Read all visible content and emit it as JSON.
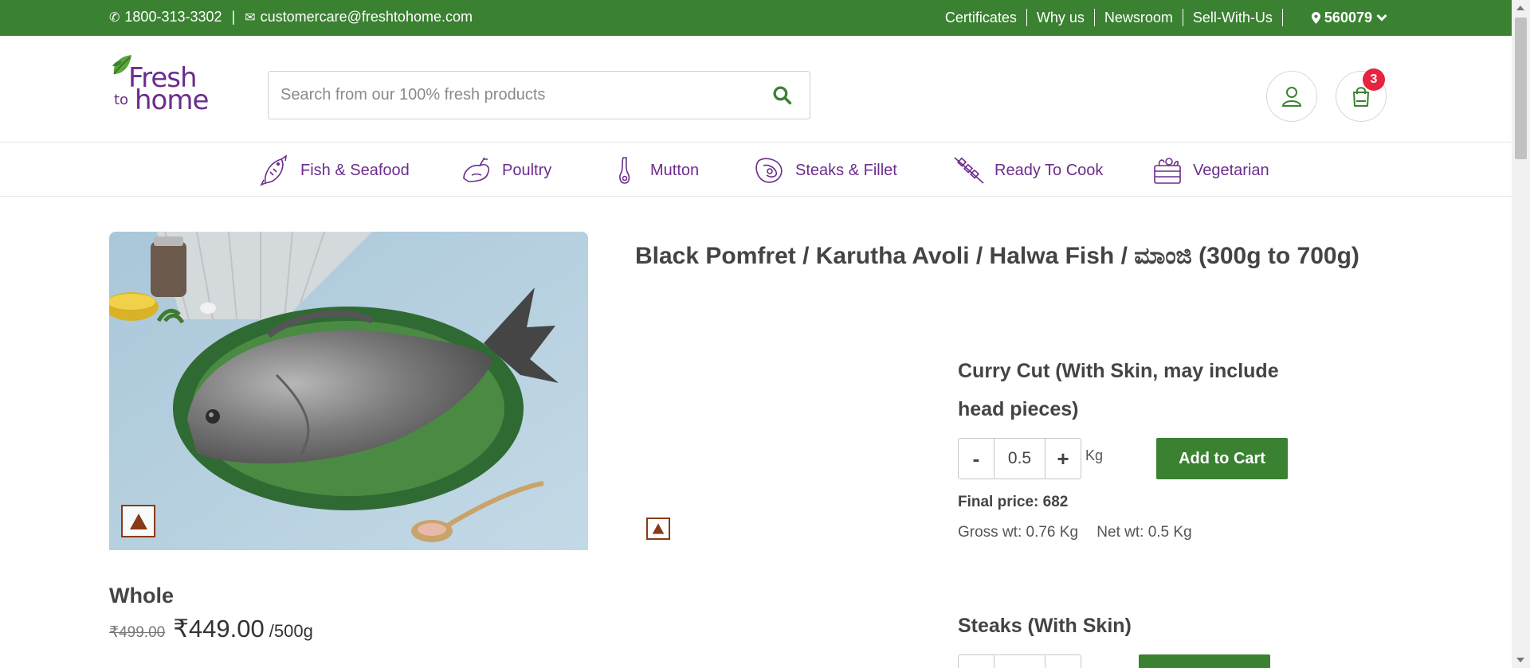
{
  "topbar": {
    "phone": "1800-313-3302",
    "separator": "|",
    "email": "customercare@freshtohome.com",
    "links": [
      "Certificates",
      "Why us",
      "Newsroom",
      "Sell-With-Us"
    ],
    "pincode": "560079"
  },
  "header": {
    "logo": {
      "line1": "Fresh",
      "line2": "to",
      "line3": "home"
    },
    "search_placeholder": "Search from our 100% fresh products",
    "cart_count": "3"
  },
  "categories": [
    {
      "label": "Fish & Seafood",
      "icon": "fish-icon"
    },
    {
      "label": "Poultry",
      "icon": "chicken-icon"
    },
    {
      "label": "Mutton",
      "icon": "mutton-leg-icon"
    },
    {
      "label": "Steaks & Fillet",
      "icon": "steak-icon"
    },
    {
      "label": "Ready To Cook",
      "icon": "skewer-icon"
    },
    {
      "label": "Vegetarian",
      "icon": "vegetable-basket-icon"
    }
  ],
  "product": {
    "title": "Black Pomfret / Karutha Avoli / Halwa Fish / ಮಾಂಜಿ (300g to 700g)",
    "image": "black-pomfret-on-green-plate",
    "variant_label": "Whole",
    "mrp": "₹499.00",
    "price": "₹449.00",
    "unit": "/500g",
    "variants": [
      {
        "name": "Curry Cut (With Skin, may include head pieces)",
        "qty_minus": "-",
        "qty": "0.5",
        "qty_plus": "+",
        "qty_unit": "Kg",
        "add_label": "Add to Cart",
        "final_price": "Final price: 682",
        "gross_wt": "Gross wt: 0.76 Kg",
        "net_wt": "Net wt: 0.5 Kg"
      },
      {
        "name": "Steaks (With Skin)"
      }
    ]
  },
  "colors": {
    "brand_green": "#3b8132",
    "brand_purple": "#6c2d8b",
    "badge_red": "#e8233f",
    "play_brown": "#8b3a18"
  }
}
